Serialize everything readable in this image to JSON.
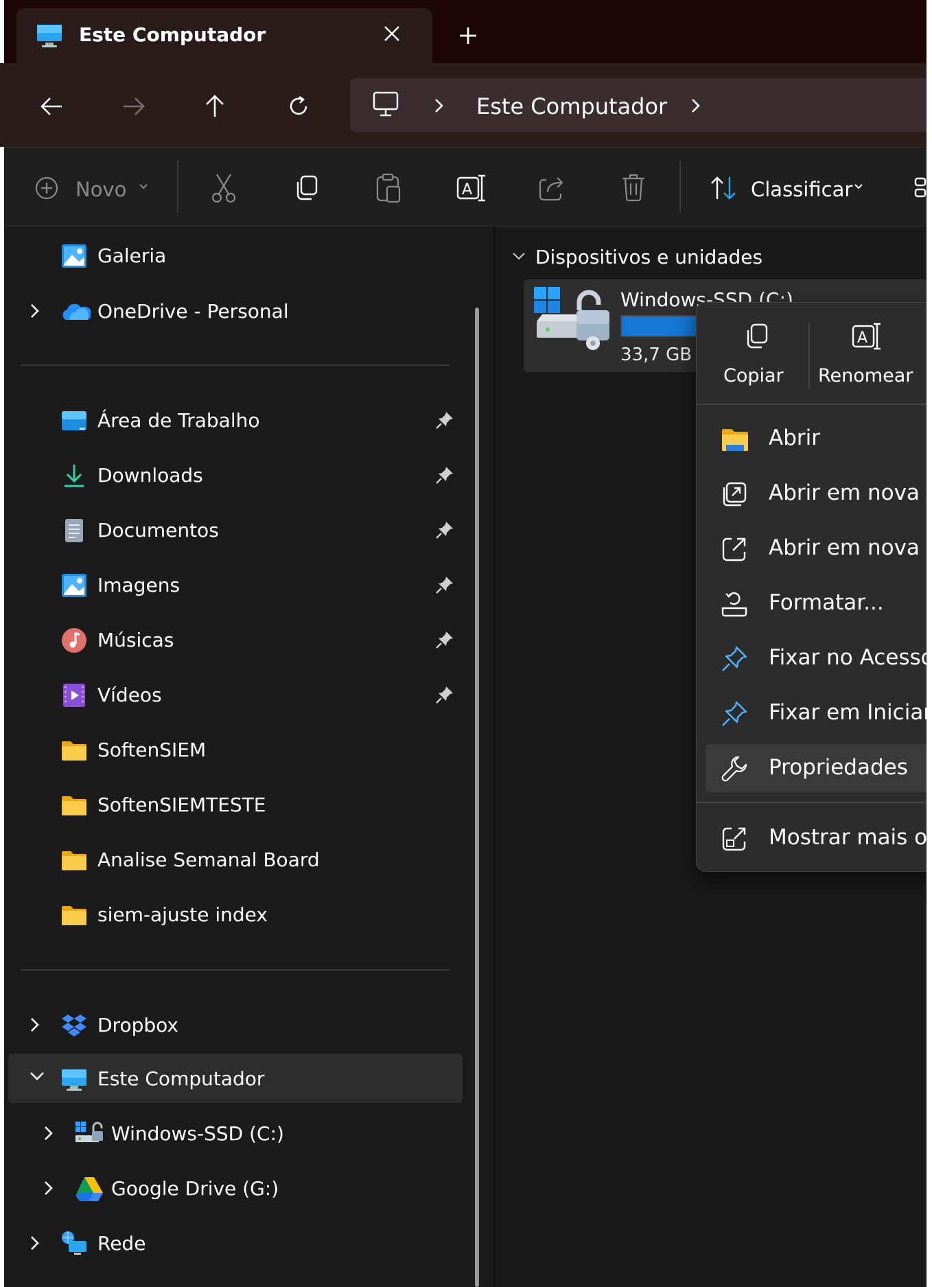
{
  "tab": {
    "title": "Este Computador",
    "close_icon": "close-icon",
    "new_tab_icon": "plus-icon"
  },
  "nav": {
    "back_icon": "arrow-left-icon",
    "forward_icon": "arrow-right-icon",
    "up_icon": "arrow-up-icon",
    "refresh_icon": "refresh-icon",
    "address": {
      "location_icon": "monitor-icon",
      "segment": "Este Computador"
    }
  },
  "toolbar": {
    "new_label": "Novo",
    "sort_label": "Classificar",
    "icons": [
      "plus-circle-icon",
      "cut-icon",
      "copy-icon",
      "paste-icon",
      "rename-icon",
      "share-icon",
      "delete-icon",
      "sort-icon",
      "view-icon"
    ]
  },
  "sidebar": {
    "top_items": [
      {
        "label": "Galeria",
        "icon": "gallery-icon",
        "expandable": false
      },
      {
        "label": "OneDrive - Personal",
        "icon": "onedrive-icon",
        "expandable": true
      }
    ],
    "quick_access": [
      {
        "label": "Área de Trabalho",
        "icon": "desktop-icon",
        "pinned": true
      },
      {
        "label": "Downloads",
        "icon": "download-icon",
        "pinned": true
      },
      {
        "label": "Documentos",
        "icon": "document-icon",
        "pinned": true
      },
      {
        "label": "Imagens",
        "icon": "pictures-icon",
        "pinned": true
      },
      {
        "label": "Músicas",
        "icon": "music-icon",
        "pinned": true
      },
      {
        "label": "Vídeos",
        "icon": "videos-icon",
        "pinned": true
      },
      {
        "label": "SoftenSIEM",
        "icon": "folder-icon",
        "pinned": false
      },
      {
        "label": "SoftenSIEMTESTE",
        "icon": "folder-icon",
        "pinned": false
      },
      {
        "label": "Analise Semanal Board",
        "icon": "folder-icon",
        "pinned": false
      },
      {
        "label": "siem-ajuste index",
        "icon": "folder-icon",
        "pinned": false
      }
    ],
    "tree": [
      {
        "label": "Dropbox",
        "icon": "dropbox-icon",
        "expanded": false,
        "selected": false
      },
      {
        "label": "Este Computador",
        "icon": "monitor-icon",
        "expanded": true,
        "selected": true
      },
      {
        "label": "Windows-SSD (C:)",
        "icon": "drive-icon",
        "expanded": false,
        "selected": false,
        "child": true
      },
      {
        "label": "Google Drive (G:)",
        "icon": "google-drive-icon",
        "expanded": false,
        "selected": false,
        "child": true
      },
      {
        "label": "Rede",
        "icon": "network-icon",
        "expanded": false,
        "selected": false
      }
    ]
  },
  "main": {
    "group_header": "Dispositivos e unidades",
    "drive": {
      "name": "Windows-SSD (C:)",
      "free_text": "33,7 GB",
      "used_fraction": 0.77,
      "icon": "bitlocker-drive-icon"
    }
  },
  "context_menu": {
    "top_actions": [
      {
        "label": "Copiar",
        "icon": "copy-icon"
      },
      {
        "label": "Renomear",
        "icon": "rename-icon"
      }
    ],
    "items": [
      {
        "label": "Abrir",
        "icon": "folder-open-icon"
      },
      {
        "label": "Abrir em nova",
        "icon": "open-new-tab-icon"
      },
      {
        "label": "Abrir em nova",
        "icon": "open-new-window-icon"
      },
      {
        "label": "Formatar...",
        "icon": "format-icon"
      },
      {
        "label": "Fixar no Acesso",
        "icon": "pin-icon"
      },
      {
        "label": "Fixar em Iniciar",
        "icon": "pin-icon"
      },
      {
        "label": "Propriedades",
        "icon": "wrench-icon",
        "hover": true
      }
    ],
    "more_options": {
      "label": "Mostrar mais o",
      "icon": "show-more-icon"
    }
  },
  "colors": {
    "accent": "#1677d6",
    "folder": "#f4c542",
    "pin": "#cfcfcf"
  }
}
